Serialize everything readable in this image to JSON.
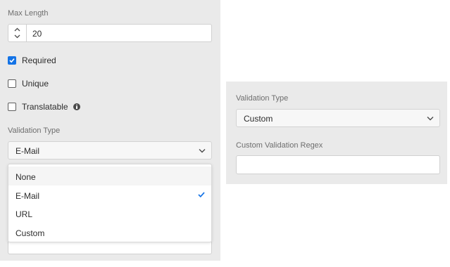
{
  "left": {
    "max_length": {
      "label": "Max Length",
      "value": "20"
    },
    "required": {
      "label": "Required",
      "checked": true
    },
    "unique": {
      "label": "Unique",
      "checked": false
    },
    "translatable": {
      "label": "Translatable",
      "checked": false
    },
    "validation_type": {
      "label": "Validation Type",
      "value": "E-Mail"
    },
    "dropdown": {
      "options": [
        {
          "label": "None",
          "highlighted": true
        },
        {
          "label": "E-Mail",
          "selected": true
        },
        {
          "label": "URL"
        },
        {
          "label": "Custom"
        }
      ]
    }
  },
  "right": {
    "validation_type": {
      "label": "Validation Type",
      "value": "Custom"
    },
    "custom_regex": {
      "label": "Custom Validation Regex",
      "value": ""
    }
  },
  "colors": {
    "accent": "#1473e6",
    "panel": "#eaeaea"
  },
  "icons": {
    "chevron": "chevron-down-icon",
    "check": "checkmark-icon",
    "info": "info-icon"
  }
}
